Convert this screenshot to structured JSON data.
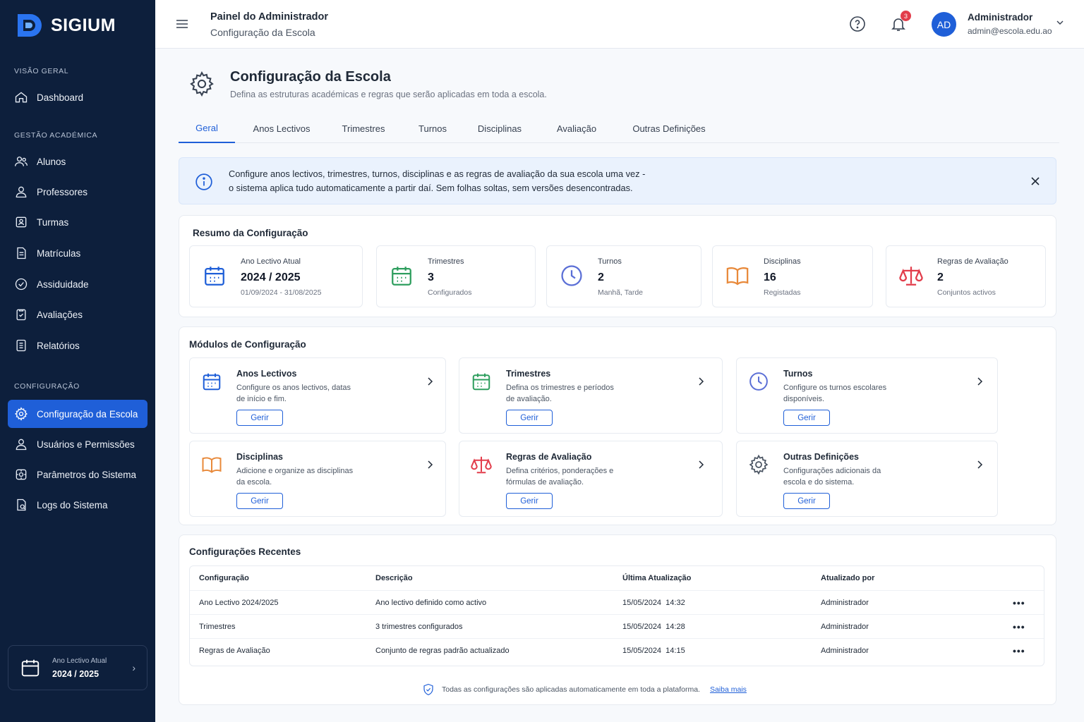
{
  "brand": {
    "name": "SIGIUM"
  },
  "sidebar": {
    "sections": [
      {
        "label": "VISÃO GERAL"
      },
      {
        "label": "GESTÃO ACADÉMICA"
      },
      {
        "label": "CONFIGURAÇÃO"
      }
    ],
    "items": [
      {
        "label": "Dashboard",
        "icon": "home-icon"
      },
      {
        "label": "Alunos",
        "icon": "users-icon"
      },
      {
        "label": "Professores",
        "icon": "user-icon"
      },
      {
        "label": "Turmas",
        "icon": "class-icon"
      },
      {
        "label": "Matrículas",
        "icon": "document-icon"
      },
      {
        "label": "Assiduidade",
        "icon": "check-circle-icon"
      },
      {
        "label": "Avaliações",
        "icon": "clipboard-check-icon"
      },
      {
        "label": "Relatórios",
        "icon": "report-icon"
      },
      {
        "label": "Configuração da Escola",
        "icon": "gear-icon",
        "active": true
      },
      {
        "label": "Usuários e Permissões",
        "icon": "user-icon"
      },
      {
        "label": "Parâmetros do Sistema",
        "icon": "sliders-icon"
      },
      {
        "label": "Logs do Sistema",
        "icon": "file-log-icon"
      }
    ],
    "year_card": {
      "label": "Ano Lectivo Atual",
      "value": "2024 / 2025"
    }
  },
  "header": {
    "title": "Painel do Administrador",
    "subtitle": "Configuração da Escola",
    "notifications": "3",
    "avatar": "AD",
    "user_name": "Administrador",
    "user_email": "admin@escola.edu.ao"
  },
  "page": {
    "title": "Configuração da Escola",
    "description": "Defina as estruturas académicas e regras que serão aplicadas em toda a escola."
  },
  "tabs": [
    {
      "label": "Geral",
      "active": true
    },
    {
      "label": "Anos Lectivos"
    },
    {
      "label": "Trimestres"
    },
    {
      "label": "Turnos"
    },
    {
      "label": "Disciplinas"
    },
    {
      "label": "Avaliação"
    },
    {
      "label": "Outras Definições"
    }
  ],
  "banner": {
    "line1": "Configure anos lectivos, trimestres, turnos, disciplinas e as regras de avaliação da sua escola uma vez -",
    "line2": "o sistema aplica tudo automaticamente a partir daí. Sem folhas soltas, sem versões desencontradas."
  },
  "summary": {
    "title": "Resumo da Configuração",
    "cards": [
      {
        "label": "Ano Lectivo Atual",
        "value": "2024 / 2025",
        "sub": "01/09/2024 - 31/08/2025",
        "icon": "calendar-icon",
        "color": "#1f5fd8"
      },
      {
        "label": "Trimestres",
        "value": "3",
        "sub": "Configurados",
        "icon": "calendar-icon",
        "color": "#2e9e5e"
      },
      {
        "label": "Turnos",
        "value": "2",
        "sub": "Manhã, Tarde",
        "icon": "clock-icon",
        "color": "#5b6fd6"
      },
      {
        "label": "Disciplinas",
        "value": "16",
        "sub": "Registadas",
        "icon": "book-icon",
        "color": "#e8893a"
      },
      {
        "label": "Regras de Avaliação",
        "value": "2",
        "sub": "Conjuntos activos",
        "icon": "scale-icon",
        "color": "#e23d4b"
      }
    ]
  },
  "modules": {
    "title": "Módulos de Configuração",
    "button_label": "Gerir",
    "cards": [
      {
        "title": "Anos Lectivos",
        "desc1": "Configure os anos lectivos, datas",
        "desc2": "de início e fim.",
        "icon": "calendar-icon",
        "color": "#1f5fd8"
      },
      {
        "title": "Trimestres",
        "desc1": "Defina os trimestres e períodos",
        "desc2": "de avaliação.",
        "icon": "calendar-icon",
        "color": "#2e9e5e"
      },
      {
        "title": "Turnos",
        "desc1": "Configure os turnos escolares",
        "desc2": "disponíveis.",
        "icon": "clock-icon",
        "color": "#5b6fd6"
      },
      {
        "title": "Disciplinas",
        "desc1": "Adicione e organize as disciplinas",
        "desc2": "da escola.",
        "icon": "book-icon",
        "color": "#e8893a"
      },
      {
        "title": "Regras de Avaliação",
        "desc1": "Defina critérios, ponderações e",
        "desc2": "fórmulas de avaliação.",
        "icon": "scale-icon",
        "color": "#e23d4b"
      },
      {
        "title": "Outras Definições",
        "desc1": "Configurações adicionais da",
        "desc2": "escola e do sistema.",
        "icon": "gear-icon",
        "color": "#4b5563"
      }
    ]
  },
  "recent": {
    "title": "Configurações Recentes",
    "columns": [
      "Configuração",
      "Descrição",
      "Última Atualização",
      "Atualizado por"
    ],
    "rows": [
      {
        "config": "Ano Lectivo 2024/2025",
        "desc": "Ano lectivo definido como activo",
        "date": "15/05/2024  14:32",
        "by": "Administrador"
      },
      {
        "config": "Trimestres",
        "desc": "3 trimestres configurados",
        "date": "15/05/2024  14:28",
        "by": "Administrador"
      },
      {
        "config": "Regras de Avaliação",
        "desc": "Conjunto de regras padrão actualizado",
        "date": "15/05/2024  14:15",
        "by": "Administrador"
      }
    ],
    "actions": "•••",
    "footnote": "Todas as configurações são aplicadas automaticamente em toda a plataforma.",
    "footnote_link": "Saiba mais"
  },
  "colors": {
    "sidebar_bg": "#0d1f3c",
    "accent": "#1f5fd8",
    "badge": "#e23d4b"
  }
}
